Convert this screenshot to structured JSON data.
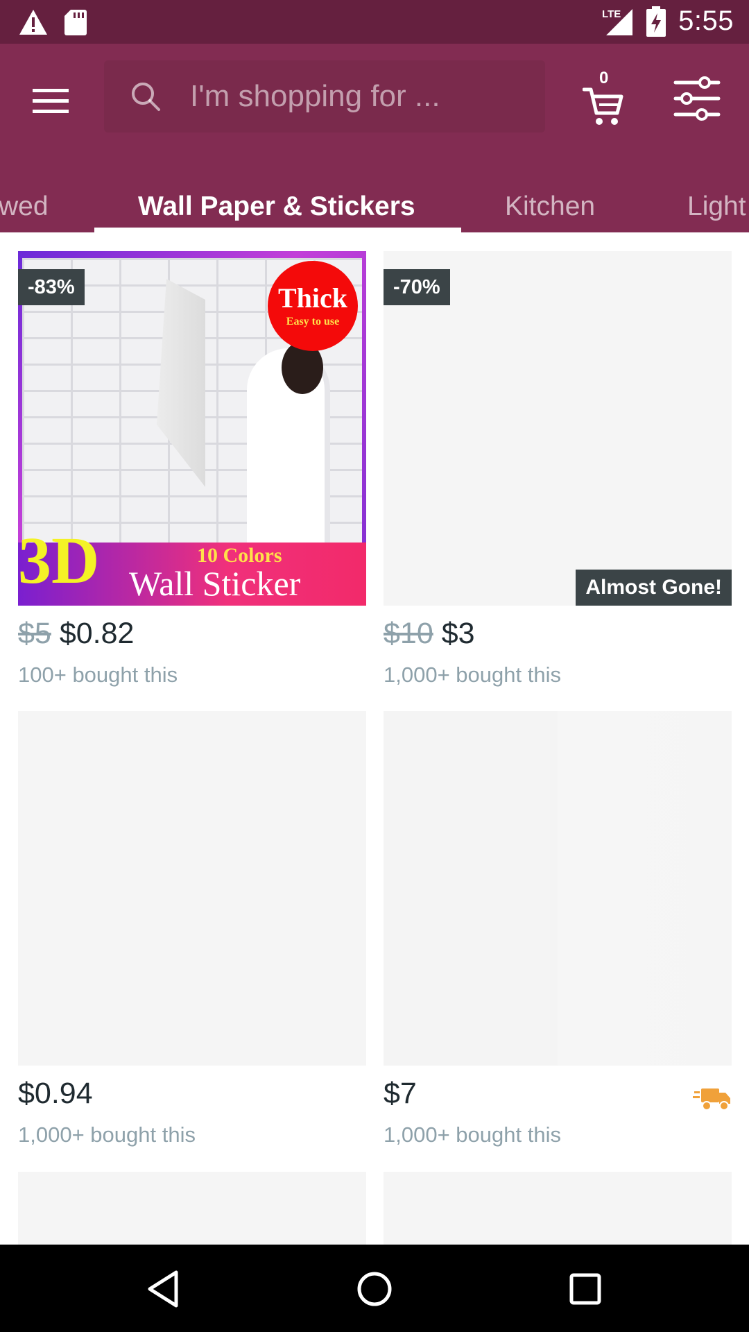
{
  "status_bar": {
    "time": "5:55",
    "network": "LTE",
    "icons": [
      "warning-icon",
      "sd-card-icon",
      "signal-icon",
      "battery-charging-icon"
    ]
  },
  "header": {
    "search_placeholder": "I'm shopping for ...",
    "cart_count": "0"
  },
  "tabs": {
    "items": [
      {
        "label": "wed",
        "active": false
      },
      {
        "label": "Wall Paper & Stickers",
        "active": true
      },
      {
        "label": "Kitchen",
        "active": false
      },
      {
        "label": "Light",
        "active": false
      }
    ]
  },
  "products": [
    {
      "discount": "-83%",
      "old_price": "$5",
      "price": "$0.82",
      "bought": "100+ bought this",
      "image_text": {
        "thick": "Thick",
        "easy": "Easy to use",
        "three_d": "3D",
        "colors": "10 Colors",
        "sticker": "Wall Sticker"
      }
    },
    {
      "discount": "-70%",
      "badge": "Almost Gone!",
      "old_price": "$10",
      "price": "$3",
      "bought": "1,000+ bought this"
    },
    {
      "price": "$0.94",
      "bought": "1,000+ bought this"
    },
    {
      "price": "$7",
      "bought": "1,000+ bought this",
      "shipping_icon": "truck-icon"
    }
  ],
  "colors": {
    "status_bar": "#65203f",
    "app_bar": "#822c52",
    "badge": "#3b4447",
    "muted_text": "#8ea1aa",
    "truck": "#f0a13a"
  }
}
